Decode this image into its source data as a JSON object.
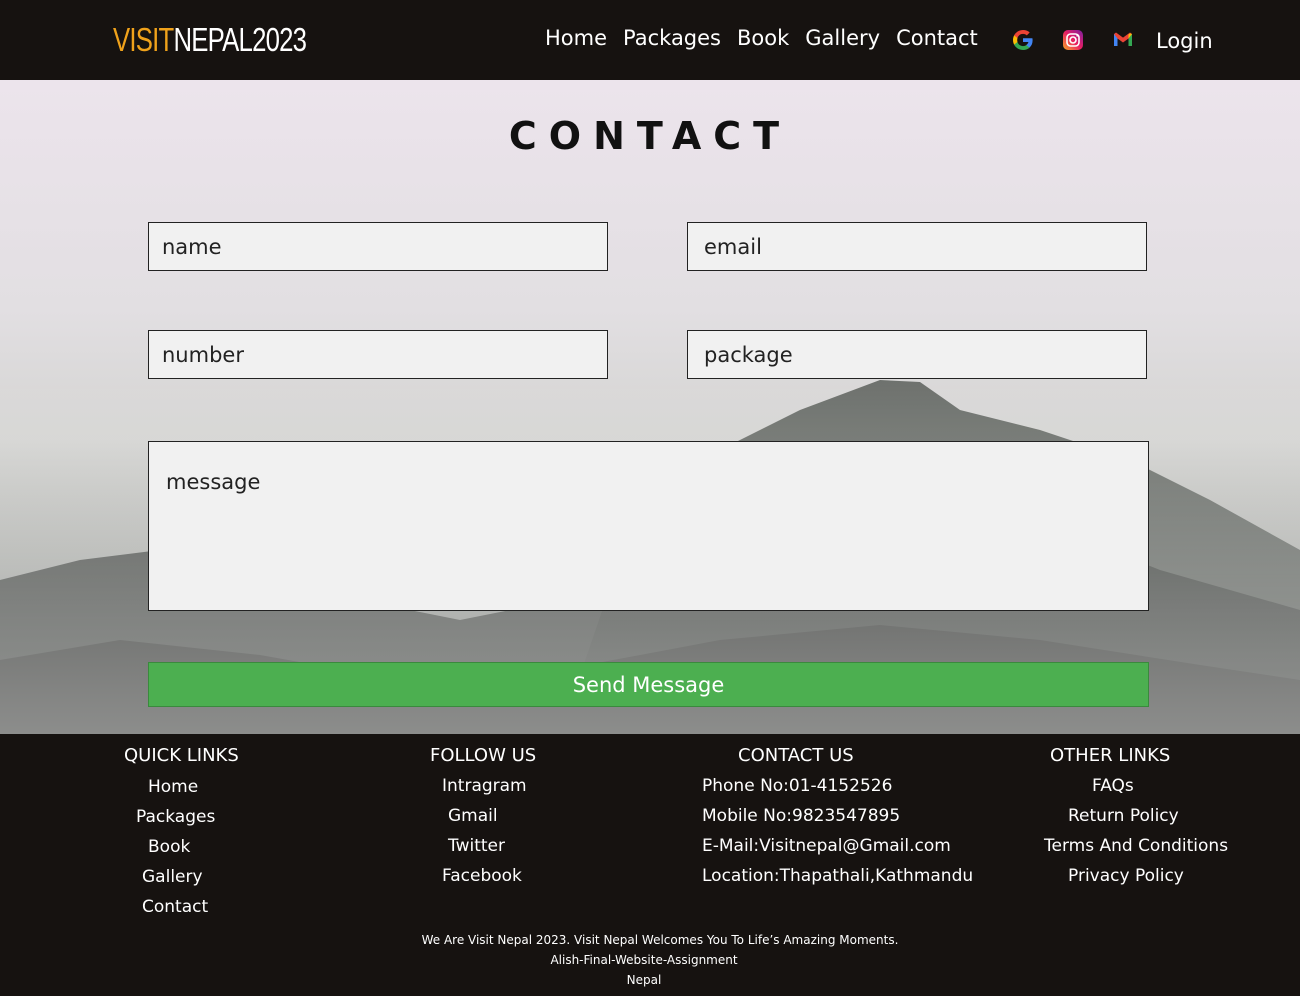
{
  "logo": {
    "accent": "VISIT",
    "rest": "NEPAL2023"
  },
  "nav": {
    "links": [
      "Home",
      "Packages",
      "Book",
      "Gallery",
      "Contact"
    ],
    "icons": [
      "google-icon",
      "instagram-icon",
      "gmail-icon"
    ],
    "login": "Login"
  },
  "contact": {
    "title": "CONTACT",
    "name_placeholder": "name",
    "email_placeholder": "email",
    "number_placeholder": "number",
    "package_placeholder": "package",
    "message_placeholder": "message",
    "send_label": "Send Message"
  },
  "footer": {
    "quick_links": {
      "title": "QUICK LINKS",
      "items": [
        "Home",
        "Packages",
        "Book",
        "Gallery",
        "Contact"
      ]
    },
    "follow_us": {
      "title": "FOLLOW US",
      "items": [
        "Intragram",
        "Gmail",
        "Twitter",
        "Facebook"
      ]
    },
    "contact_us": {
      "title": "CONTACT US",
      "items": [
        "Phone No:01-4152526",
        "Mobile No:9823547895",
        "E-Mail:Visitnepal@Gmail.com",
        "Location:Thapathali,Kathmandu"
      ]
    },
    "other_links": {
      "title": "OTHER LINKS",
      "items": [
        "FAQs",
        "Return Policy",
        "Terms And Conditions",
        "Privacy Policy"
      ]
    },
    "tagline": "We Are Visit Nepal 2023. Visit Nepal Welcomes You To Life’s Amazing Moments.",
    "credit": "Alish-Final-Website-Assignment",
    "country": "Nepal"
  },
  "colors": {
    "accent": "#f0a21b",
    "dark_bg": "#161210",
    "button": "#4caf50"
  }
}
